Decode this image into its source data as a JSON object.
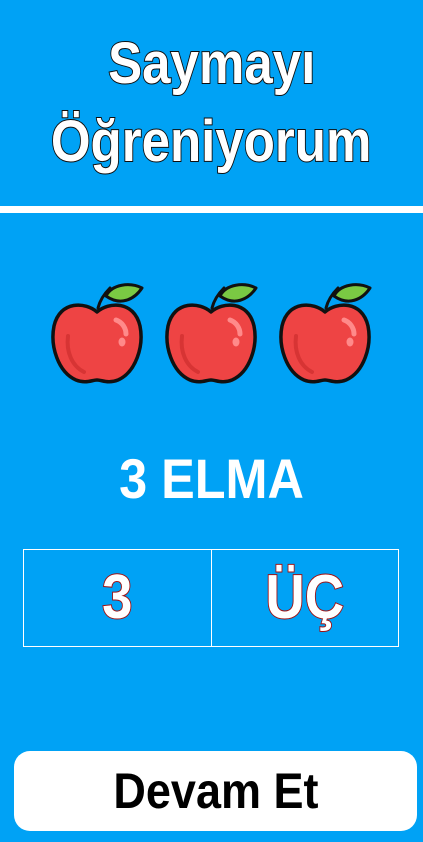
{
  "header": {
    "title_line1": "Saymayı",
    "title_line2": "Öğreniyorum"
  },
  "apples": {
    "count": 3,
    "icon": "apple-icon",
    "colors": {
      "body": "#ee4444",
      "highlight": "#ff8080",
      "leaf": "#7ac943",
      "outline": "#111111"
    }
  },
  "count_label": "3 ELMA",
  "answers": {
    "digit": "3",
    "word": "ÜÇ"
  },
  "continue_button": {
    "label": "Devam Et"
  },
  "colors": {
    "background": "#00a2f5",
    "text": "#ffffff",
    "answer_outline": "#a11010",
    "button_bg": "#ffffff"
  }
}
